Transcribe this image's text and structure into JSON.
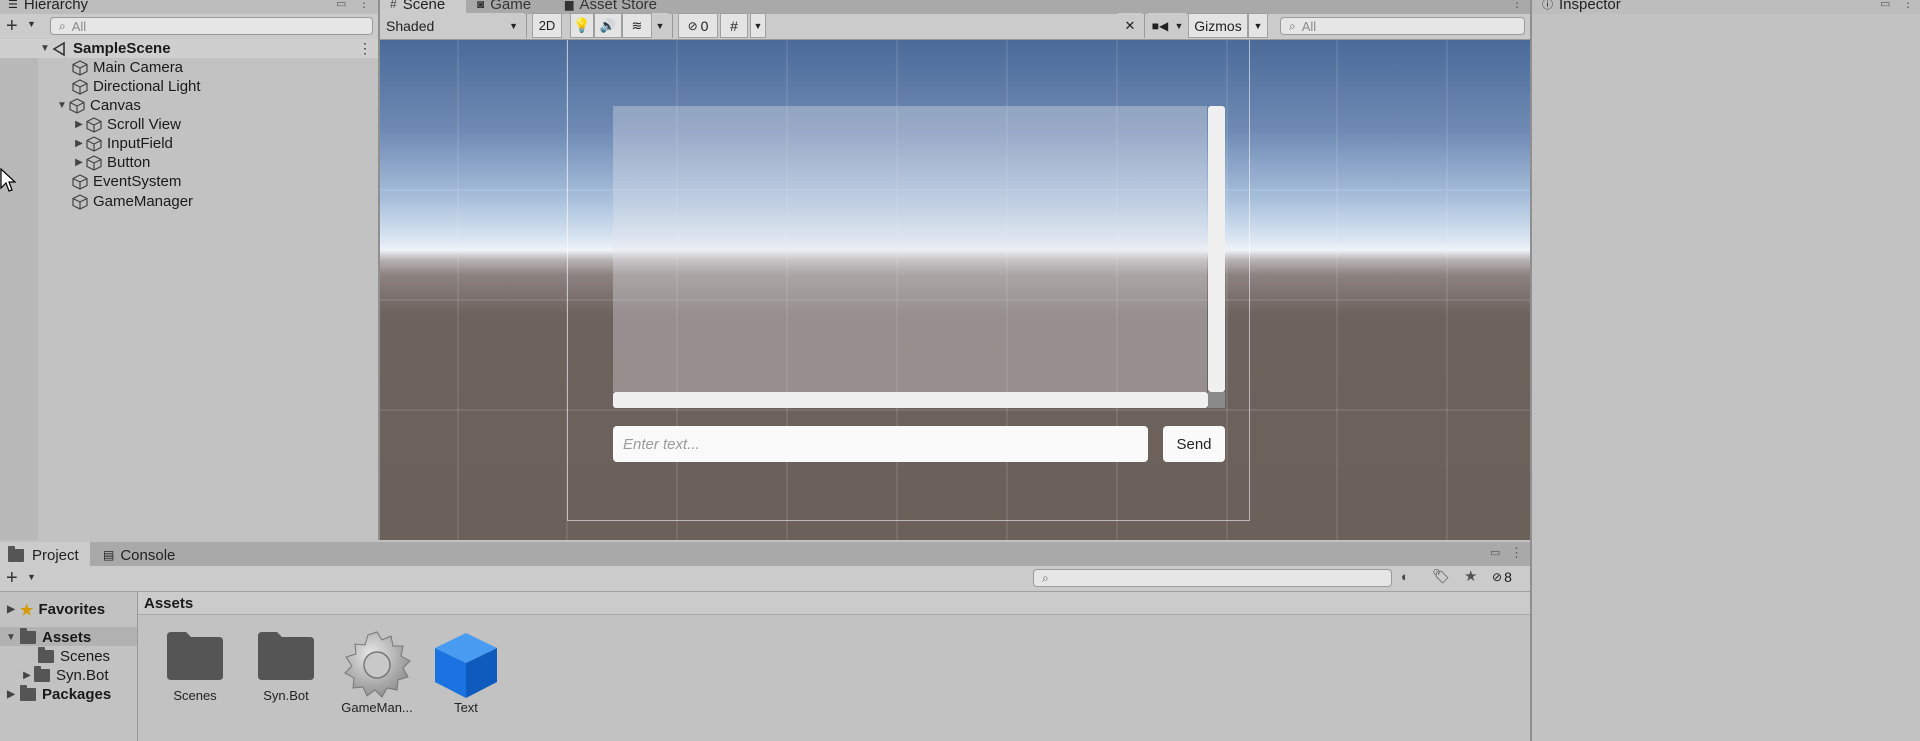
{
  "hierarchy": {
    "title": "Hierarchy",
    "search_placeholder": "All",
    "scene_name": "SampleScene",
    "items": [
      {
        "label": "Main Camera"
      },
      {
        "label": "Directional Light"
      },
      {
        "label": "Canvas"
      },
      {
        "label": "Scroll View"
      },
      {
        "label": "InputField"
      },
      {
        "label": "Button"
      },
      {
        "label": "EventSystem"
      },
      {
        "label": "GameManager"
      }
    ]
  },
  "scene_tabs": [
    {
      "label": "Scene"
    },
    {
      "label": "Game"
    },
    {
      "label": "Asset Store"
    }
  ],
  "scene_toolbar": {
    "shading_mode": "Shaded",
    "mode_2d": "2D",
    "hidden_count": "0",
    "gizmos_label": "Gizmos",
    "search_placeholder": "All"
  },
  "game_ui": {
    "input_placeholder": "Enter text...",
    "send_label": "Send"
  },
  "inspector": {
    "title": "Inspector"
  },
  "bottom_tabs": [
    {
      "label": "Project"
    },
    {
      "label": "Console"
    }
  ],
  "project": {
    "hidden_count": "8",
    "favorites_label": "Favorites",
    "assets_label": "Assets",
    "scenes_label": "Scenes",
    "synbot_label": "Syn.Bot",
    "packages_label": "Packages",
    "breadcrumb": "Assets",
    "asset_items": [
      {
        "label": "Scenes",
        "icon": "folder-icon"
      },
      {
        "label": "Syn.Bot",
        "icon": "folder-icon"
      },
      {
        "label": "GameMan...",
        "icon": "gear-script-icon"
      },
      {
        "label": "Text",
        "icon": "prefab-cube-icon"
      }
    ]
  },
  "colors": {
    "sky_top": "#4b6a98",
    "horizon": "#e6eef6",
    "ground": "#6e625e",
    "prefab_blue": "#1a73e0"
  }
}
